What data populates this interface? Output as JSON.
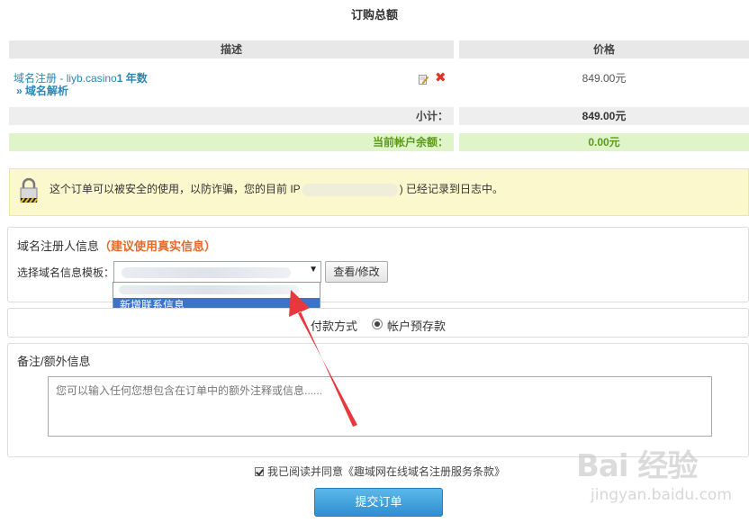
{
  "page": {
    "title": "订购总额"
  },
  "table": {
    "header_desc": "描述",
    "header_price": "价格",
    "item": {
      "type": "域名注册",
      "separator": " - ",
      "domain": "liyb.casino",
      "years": "1 年数",
      "addon": "» 域名解析",
      "price": "849.00元"
    },
    "subtotal_label": "小计：",
    "subtotal_value": "849.00元",
    "balance_label": "当前帐户余额：",
    "balance_value": "0.00元"
  },
  "notice": {
    "text_before": "这个订单可以被安全的使用，以防诈骗，您的目前 IP",
    "text_after": ") 已经记录到日志中。"
  },
  "registrant": {
    "title": "域名注册人信息",
    "hint": "（建议使用真实信息）",
    "template_label": "选择域名信息模板：",
    "view_edit_button": "查看/修改",
    "dropdown_selected_option": "新增联系信息"
  },
  "payment": {
    "label": "付款方式",
    "option": "帐户预存款"
  },
  "notes": {
    "title": "备注/额外信息",
    "placeholder": "您可以输入任何您想包含在订单中的额外注释或信息......"
  },
  "agreement": {
    "text": "我已阅读并同意",
    "link": "《趣域网在线域名注册服务条款》"
  },
  "submit_button": "提交订单",
  "watermark": {
    "main": "Bai 经验",
    "sub": "jingyan.baidu.com"
  },
  "colors": {
    "link": "#2a88b8",
    "hint_orange": "#e8672a",
    "balance_green": "#5a9a1a",
    "arrow_red": "#e8383d",
    "submit_blue": "#2e8fcf",
    "dropdown_highlight": "#3a73c9"
  }
}
